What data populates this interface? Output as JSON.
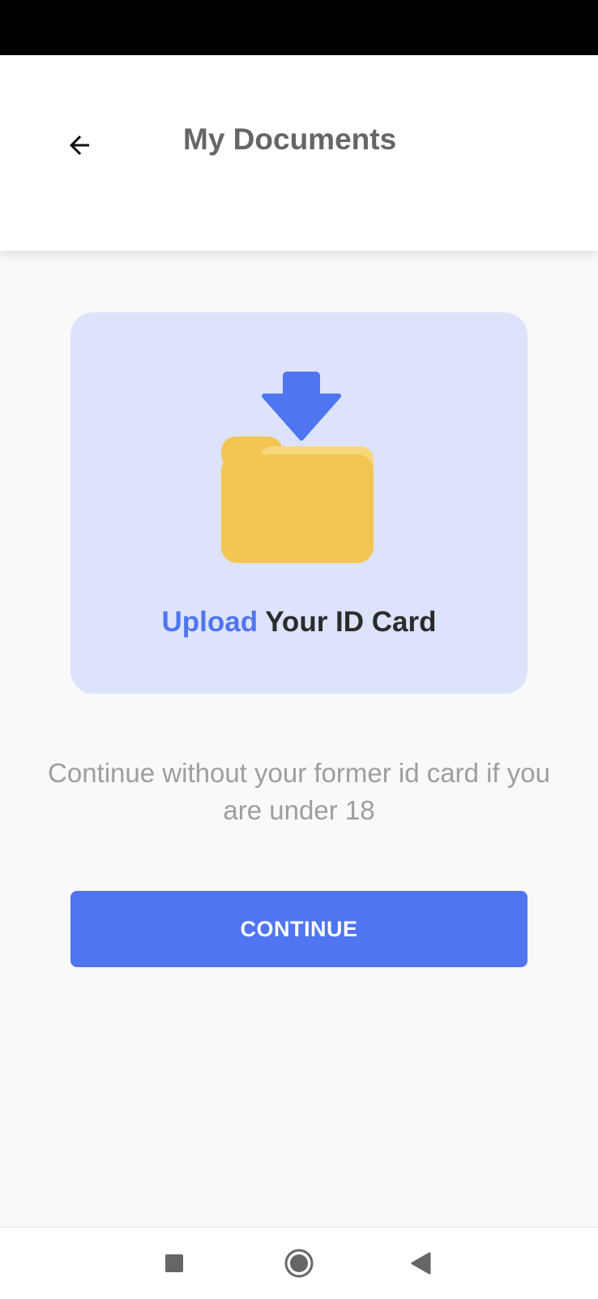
{
  "header": {
    "title": "My Documents",
    "back_icon": "arrow-left-icon"
  },
  "upload_card": {
    "caption_accent": "Upload",
    "caption_rest": "Your ID Card",
    "illustration_icon": "folder-download-icon"
  },
  "helper_text": "Continue without your former id card if you are under 18",
  "continue_button": {
    "label": "CONTINUE"
  },
  "nav_bar": {
    "recents_icon": "square-icon",
    "home_icon": "circle-icon",
    "back_icon": "triangle-back-icon"
  },
  "colors": {
    "accent": "#4f75f0",
    "card_background": "#dce3fb",
    "folder": "#f2c651",
    "folder_tab": "#f7d77e",
    "helper_text": "#9e9e9e",
    "title": "#666666",
    "page_background": "#f9f9f9"
  }
}
